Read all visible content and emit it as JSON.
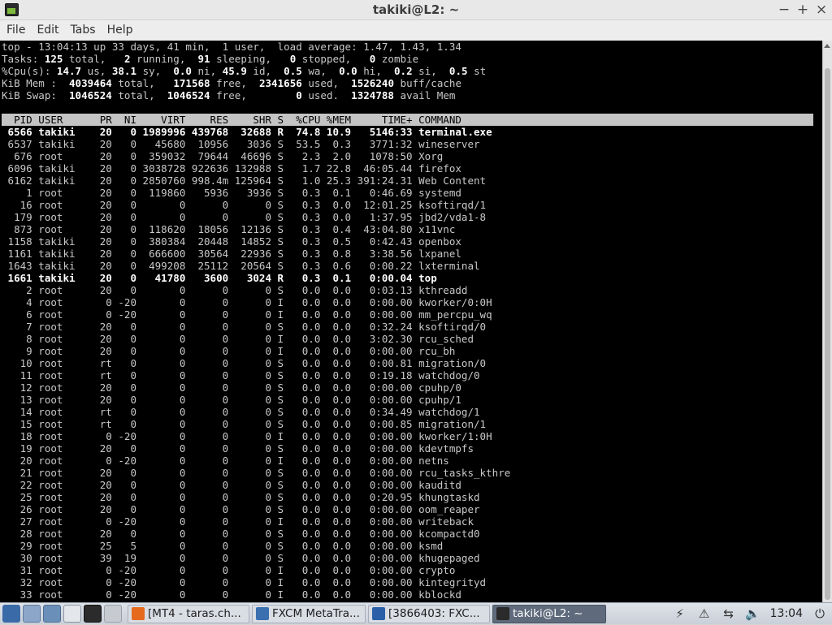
{
  "window": {
    "title": "takiki@L2: ~",
    "buttons": {
      "minimize": "−",
      "maximize": "+",
      "close": "×"
    }
  },
  "menu": [
    "File",
    "Edit",
    "Tabs",
    "Help"
  ],
  "top": {
    "summary_lines": [
      "top - 13:04:13 up 33 days, 41 min,  1 user,  load average: 1.47, 1.43, 1.34",
      "Tasks: |125| total,   |2| running,  |91| sleeping,   |0| stopped,   |0| zombie",
      "%Cpu(s): |14.7| us, |38.1| sy,  |0.0| ni, |45.9| id,  |0.5| wa,  |0.0| hi,  |0.2| si,  |0.5| st",
      "KiB Mem : | 4039464| total,   |171568| free,  |2341656| used,  |1526240| buff/cache",
      "KiB Swap: | 1046524| total,  |1046524| free,        |0| used.  |1324788| avail Mem"
    ],
    "header": "  PID USER      PR  NI    VIRT    RES    SHR S  %CPU %MEM     TIME+ COMMAND",
    "processes": [
      {
        "pid": "6566",
        "user": "takiki",
        "pr": "20",
        "ni": "0",
        "virt": "1989996",
        "res": "439768",
        "shr": "32688",
        "s": "R",
        "cpu": "74.8",
        "mem": "10.9",
        "time": "5146:33",
        "cmd": "terminal.exe",
        "bold": true
      },
      {
        "pid": "6537",
        "user": "takiki",
        "pr": "20",
        "ni": "0",
        "virt": "45680",
        "res": "10956",
        "shr": "3036",
        "s": "S",
        "cpu": "53.5",
        "mem": "0.3",
        "time": "3771:32",
        "cmd": "wineserver"
      },
      {
        "pid": "676",
        "user": "root",
        "pr": "20",
        "ni": "0",
        "virt": "359032",
        "res": "79644",
        "shr": "46696",
        "s": "S",
        "cpu": "2.3",
        "mem": "2.0",
        "time": "1078:50",
        "cmd": "Xorg"
      },
      {
        "pid": "6096",
        "user": "takiki",
        "pr": "20",
        "ni": "0",
        "virt": "3038728",
        "res": "922636",
        "shr": "132988",
        "s": "S",
        "cpu": "1.7",
        "mem": "22.8",
        "time": "46:05.44",
        "cmd": "firefox"
      },
      {
        "pid": "6162",
        "user": "takiki",
        "pr": "20",
        "ni": "0",
        "virt": "2850760",
        "res": "998.4m",
        "shr": "125964",
        "s": "S",
        "cpu": "1.0",
        "mem": "25.3",
        "time": "391:24.31",
        "cmd": "Web Content"
      },
      {
        "pid": "1",
        "user": "root",
        "pr": "20",
        "ni": "0",
        "virt": "119860",
        "res": "5936",
        "shr": "3936",
        "s": "S",
        "cpu": "0.3",
        "mem": "0.1",
        "time": "0:46.69",
        "cmd": "systemd"
      },
      {
        "pid": "16",
        "user": "root",
        "pr": "20",
        "ni": "0",
        "virt": "0",
        "res": "0",
        "shr": "0",
        "s": "S",
        "cpu": "0.3",
        "mem": "0.0",
        "time": "12:01.25",
        "cmd": "ksoftirqd/1"
      },
      {
        "pid": "179",
        "user": "root",
        "pr": "20",
        "ni": "0",
        "virt": "0",
        "res": "0",
        "shr": "0",
        "s": "S",
        "cpu": "0.3",
        "mem": "0.0",
        "time": "1:37.95",
        "cmd": "jbd2/vda1-8"
      },
      {
        "pid": "873",
        "user": "root",
        "pr": "20",
        "ni": "0",
        "virt": "118620",
        "res": "18056",
        "shr": "12136",
        "s": "S",
        "cpu": "0.3",
        "mem": "0.4",
        "time": "43:04.80",
        "cmd": "x11vnc"
      },
      {
        "pid": "1158",
        "user": "takiki",
        "pr": "20",
        "ni": "0",
        "virt": "380384",
        "res": "20448",
        "shr": "14852",
        "s": "S",
        "cpu": "0.3",
        "mem": "0.5",
        "time": "0:42.43",
        "cmd": "openbox"
      },
      {
        "pid": "1161",
        "user": "takiki",
        "pr": "20",
        "ni": "0",
        "virt": "666600",
        "res": "30564",
        "shr": "22936",
        "s": "S",
        "cpu": "0.3",
        "mem": "0.8",
        "time": "3:38.56",
        "cmd": "lxpanel"
      },
      {
        "pid": "1643",
        "user": "takiki",
        "pr": "20",
        "ni": "0",
        "virt": "499208",
        "res": "25112",
        "shr": "20564",
        "s": "S",
        "cpu": "0.3",
        "mem": "0.6",
        "time": "0:00.22",
        "cmd": "lxterminal"
      },
      {
        "pid": "1661",
        "user": "takiki",
        "pr": "20",
        "ni": "0",
        "virt": "41780",
        "res": "3600",
        "shr": "3024",
        "s": "R",
        "cpu": "0.3",
        "mem": "0.1",
        "time": "0:00.04",
        "cmd": "top",
        "bold": true
      },
      {
        "pid": "2",
        "user": "root",
        "pr": "20",
        "ni": "0",
        "virt": "0",
        "res": "0",
        "shr": "0",
        "s": "S",
        "cpu": "0.0",
        "mem": "0.0",
        "time": "0:03.13",
        "cmd": "kthreadd"
      },
      {
        "pid": "4",
        "user": "root",
        "pr": "0",
        "ni": "-20",
        "virt": "0",
        "res": "0",
        "shr": "0",
        "s": "I",
        "cpu": "0.0",
        "mem": "0.0",
        "time": "0:00.00",
        "cmd": "kworker/0:0H"
      },
      {
        "pid": "6",
        "user": "root",
        "pr": "0",
        "ni": "-20",
        "virt": "0",
        "res": "0",
        "shr": "0",
        "s": "I",
        "cpu": "0.0",
        "mem": "0.0",
        "time": "0:00.00",
        "cmd": "mm_percpu_wq"
      },
      {
        "pid": "7",
        "user": "root",
        "pr": "20",
        "ni": "0",
        "virt": "0",
        "res": "0",
        "shr": "0",
        "s": "S",
        "cpu": "0.0",
        "mem": "0.0",
        "time": "0:32.24",
        "cmd": "ksoftirqd/0"
      },
      {
        "pid": "8",
        "user": "root",
        "pr": "20",
        "ni": "0",
        "virt": "0",
        "res": "0",
        "shr": "0",
        "s": "I",
        "cpu": "0.0",
        "mem": "0.0",
        "time": "3:02.30",
        "cmd": "rcu_sched"
      },
      {
        "pid": "9",
        "user": "root",
        "pr": "20",
        "ni": "0",
        "virt": "0",
        "res": "0",
        "shr": "0",
        "s": "I",
        "cpu": "0.0",
        "mem": "0.0",
        "time": "0:00.00",
        "cmd": "rcu_bh"
      },
      {
        "pid": "10",
        "user": "root",
        "pr": "rt",
        "ni": "0",
        "virt": "0",
        "res": "0",
        "shr": "0",
        "s": "S",
        "cpu": "0.0",
        "mem": "0.0",
        "time": "0:00.81",
        "cmd": "migration/0"
      },
      {
        "pid": "11",
        "user": "root",
        "pr": "rt",
        "ni": "0",
        "virt": "0",
        "res": "0",
        "shr": "0",
        "s": "S",
        "cpu": "0.0",
        "mem": "0.0",
        "time": "0:19.18",
        "cmd": "watchdog/0"
      },
      {
        "pid": "12",
        "user": "root",
        "pr": "20",
        "ni": "0",
        "virt": "0",
        "res": "0",
        "shr": "0",
        "s": "S",
        "cpu": "0.0",
        "mem": "0.0",
        "time": "0:00.00",
        "cmd": "cpuhp/0"
      },
      {
        "pid": "13",
        "user": "root",
        "pr": "20",
        "ni": "0",
        "virt": "0",
        "res": "0",
        "shr": "0",
        "s": "S",
        "cpu": "0.0",
        "mem": "0.0",
        "time": "0:00.00",
        "cmd": "cpuhp/1"
      },
      {
        "pid": "14",
        "user": "root",
        "pr": "rt",
        "ni": "0",
        "virt": "0",
        "res": "0",
        "shr": "0",
        "s": "S",
        "cpu": "0.0",
        "mem": "0.0",
        "time": "0:34.49",
        "cmd": "watchdog/1"
      },
      {
        "pid": "15",
        "user": "root",
        "pr": "rt",
        "ni": "0",
        "virt": "0",
        "res": "0",
        "shr": "0",
        "s": "S",
        "cpu": "0.0",
        "mem": "0.0",
        "time": "0:00.85",
        "cmd": "migration/1"
      },
      {
        "pid": "18",
        "user": "root",
        "pr": "0",
        "ni": "-20",
        "virt": "0",
        "res": "0",
        "shr": "0",
        "s": "I",
        "cpu": "0.0",
        "mem": "0.0",
        "time": "0:00.00",
        "cmd": "kworker/1:0H"
      },
      {
        "pid": "19",
        "user": "root",
        "pr": "20",
        "ni": "0",
        "virt": "0",
        "res": "0",
        "shr": "0",
        "s": "S",
        "cpu": "0.0",
        "mem": "0.0",
        "time": "0:00.00",
        "cmd": "kdevtmpfs"
      },
      {
        "pid": "20",
        "user": "root",
        "pr": "0",
        "ni": "-20",
        "virt": "0",
        "res": "0",
        "shr": "0",
        "s": "I",
        "cpu": "0.0",
        "mem": "0.0",
        "time": "0:00.00",
        "cmd": "netns"
      },
      {
        "pid": "21",
        "user": "root",
        "pr": "20",
        "ni": "0",
        "virt": "0",
        "res": "0",
        "shr": "0",
        "s": "S",
        "cpu": "0.0",
        "mem": "0.0",
        "time": "0:00.00",
        "cmd": "rcu_tasks_kthre"
      },
      {
        "pid": "22",
        "user": "root",
        "pr": "20",
        "ni": "0",
        "virt": "0",
        "res": "0",
        "shr": "0",
        "s": "S",
        "cpu": "0.0",
        "mem": "0.0",
        "time": "0:00.00",
        "cmd": "kauditd"
      },
      {
        "pid": "25",
        "user": "root",
        "pr": "20",
        "ni": "0",
        "virt": "0",
        "res": "0",
        "shr": "0",
        "s": "S",
        "cpu": "0.0",
        "mem": "0.0",
        "time": "0:20.95",
        "cmd": "khungtaskd"
      },
      {
        "pid": "26",
        "user": "root",
        "pr": "20",
        "ni": "0",
        "virt": "0",
        "res": "0",
        "shr": "0",
        "s": "S",
        "cpu": "0.0",
        "mem": "0.0",
        "time": "0:00.00",
        "cmd": "oom_reaper"
      },
      {
        "pid": "27",
        "user": "root",
        "pr": "0",
        "ni": "-20",
        "virt": "0",
        "res": "0",
        "shr": "0",
        "s": "I",
        "cpu": "0.0",
        "mem": "0.0",
        "time": "0:00.00",
        "cmd": "writeback"
      },
      {
        "pid": "28",
        "user": "root",
        "pr": "20",
        "ni": "0",
        "virt": "0",
        "res": "0",
        "shr": "0",
        "s": "S",
        "cpu": "0.0",
        "mem": "0.0",
        "time": "0:00.00",
        "cmd": "kcompactd0"
      },
      {
        "pid": "29",
        "user": "root",
        "pr": "25",
        "ni": "5",
        "virt": "0",
        "res": "0",
        "shr": "0",
        "s": "S",
        "cpu": "0.0",
        "mem": "0.0",
        "time": "0:00.00",
        "cmd": "ksmd"
      },
      {
        "pid": "30",
        "user": "root",
        "pr": "39",
        "ni": "19",
        "virt": "0",
        "res": "0",
        "shr": "0",
        "s": "S",
        "cpu": "0.0",
        "mem": "0.0",
        "time": "0:00.00",
        "cmd": "khugepaged"
      },
      {
        "pid": "31",
        "user": "root",
        "pr": "0",
        "ni": "-20",
        "virt": "0",
        "res": "0",
        "shr": "0",
        "s": "I",
        "cpu": "0.0",
        "mem": "0.0",
        "time": "0:00.00",
        "cmd": "crypto"
      },
      {
        "pid": "32",
        "user": "root",
        "pr": "0",
        "ni": "-20",
        "virt": "0",
        "res": "0",
        "shr": "0",
        "s": "I",
        "cpu": "0.0",
        "mem": "0.0",
        "time": "0:00.00",
        "cmd": "kintegrityd"
      },
      {
        "pid": "33",
        "user": "root",
        "pr": "0",
        "ni": "-20",
        "virt": "0",
        "res": "0",
        "shr": "0",
        "s": "I",
        "cpu": "0.0",
        "mem": "0.0",
        "time": "0:00.00",
        "cmd": "kblockd"
      }
    ]
  },
  "taskbar": {
    "tasks": [
      {
        "label": "[MT4 - taras.ch...",
        "icon": "firefox-icon",
        "color": "#e66a1e"
      },
      {
        "label": "FXCM MetaTra...",
        "icon": "window-icon",
        "color": "#3a6fb0"
      },
      {
        "label": "[3866403: FXC...",
        "icon": "wine-icon",
        "color": "#2a5fa8"
      },
      {
        "label": "takiki@L2: ~",
        "icon": "terminal-icon",
        "color": "#2b2b2b",
        "active": true
      }
    ],
    "clock": "13:04"
  }
}
